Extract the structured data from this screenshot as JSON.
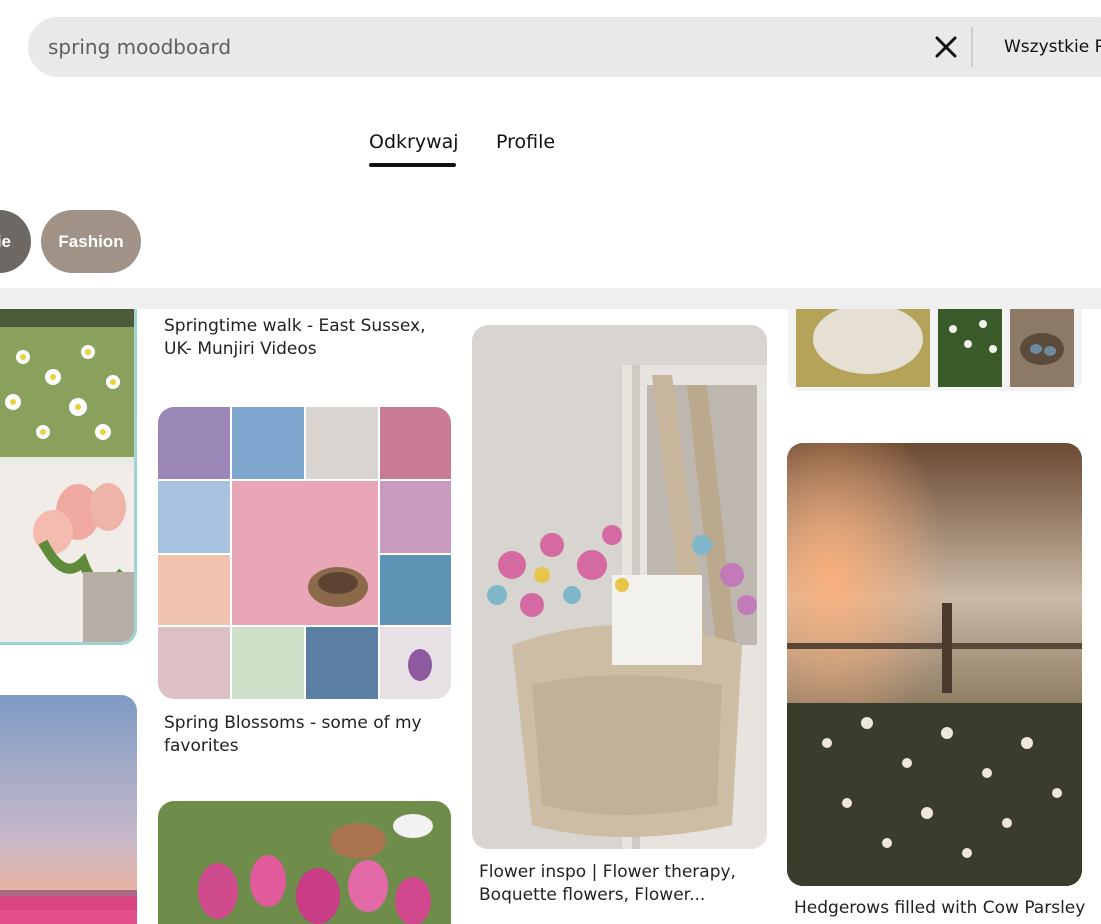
{
  "search": {
    "query": "spring moodboard",
    "scope_label": "Wszystkie Pi"
  },
  "tabs": [
    {
      "label": "Odkrywaj",
      "active": true
    },
    {
      "label": "Profile",
      "active": false
    }
  ],
  "chips": [
    {
      "label": "ie",
      "color": "#6d6863"
    },
    {
      "label": "Fashion",
      "color": "#a09287"
    }
  ],
  "pins": {
    "col2_top_title": "Springtime walk - East Sussex, UK- Munjiri Videos",
    "spring_blossoms_title": "Spring Blossoms - some of my favorites",
    "flower_inspo_title": "Flower inspo | Flower therapy, Boquette flowers, Flower...",
    "hedgerows_title": "Hedgerows filled with Cow Parsley"
  },
  "icons": {
    "clear": "close-icon"
  }
}
